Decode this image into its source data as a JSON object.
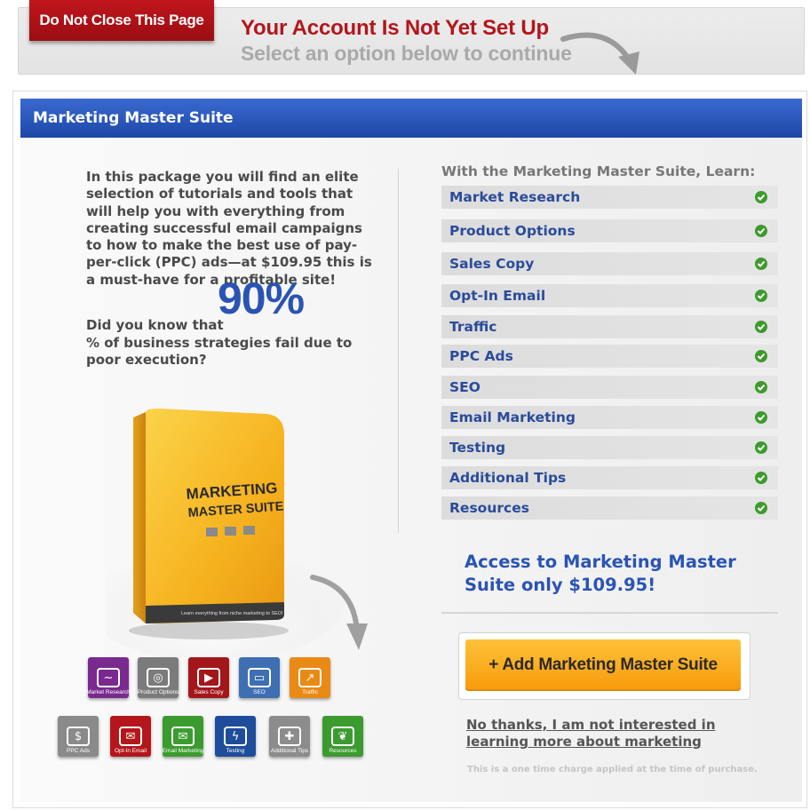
{
  "banner": {
    "tag": "Do Not Close This Page",
    "title": "Your Account Is Not Yet Set Up",
    "subtitle": "Select an option below to continue"
  },
  "panel": {
    "title": "Marketing Master Suite",
    "intro": "In this package you will find an elite selection of tutorials and tools that will help you with everything from creating successful email campaigns to how to make the best use of pay-per-click (PPC) ads—at $109.95 this is a must-have for a profitable site!",
    "stat_lead": "Did you know that",
    "stat_value": "90%",
    "stat_rest": "% of business strategies fail due to poor execution?",
    "box_title_1": "MARKETING",
    "box_title_2": "MASTER SUITE",
    "box_tagline": "Learn everything from niche marketing to SEO!",
    "icons": [
      {
        "label": "Market Research",
        "color": "#7a2a8f"
      },
      {
        "label": "Product Options",
        "color": "#7b7b7b"
      },
      {
        "label": "Sales Copy",
        "color": "#a3171b"
      },
      {
        "label": "SEO",
        "color": "#3f6fb3"
      },
      {
        "label": "Traffic",
        "color": "#e98a16"
      },
      {
        "label": "PPC Ads",
        "color": "#8a8a8a"
      },
      {
        "label": "Opt-In Email",
        "color": "#b3171b"
      },
      {
        "label": "Email Marketing",
        "color": "#3b9b2f"
      },
      {
        "label": "Testing",
        "color": "#1e4d9b"
      },
      {
        "label": "Additional Tips",
        "color": "#8c8c8c"
      },
      {
        "label": "Resources",
        "color": "#3b9b2f"
      }
    ]
  },
  "learn": {
    "title": "With the Marketing Master Suite, Learn:",
    "items": [
      "Market Research",
      "Product Options",
      "Sales Copy",
      "Opt-In Email",
      "Traffic",
      "PPC Ads",
      "SEO",
      "Email Marketing",
      "Testing",
      "Additional Tips",
      "Resources"
    ],
    "check_color": "#3c9b2c"
  },
  "offer": {
    "access_text": "Access to Marketing Master Suite only $109.95!",
    "button_label": "+ Add Marketing Master Suite",
    "decline_text": "No thanks, I am not interested in learning more about marketing",
    "fine_print": "This is a one time charge applied at the time of purchase."
  },
  "colors": {
    "brand_red": "#b3151b",
    "header_blue": "#2551b8",
    "accent_blue": "#2a54b4",
    "button_orange": "#f9a81c"
  }
}
